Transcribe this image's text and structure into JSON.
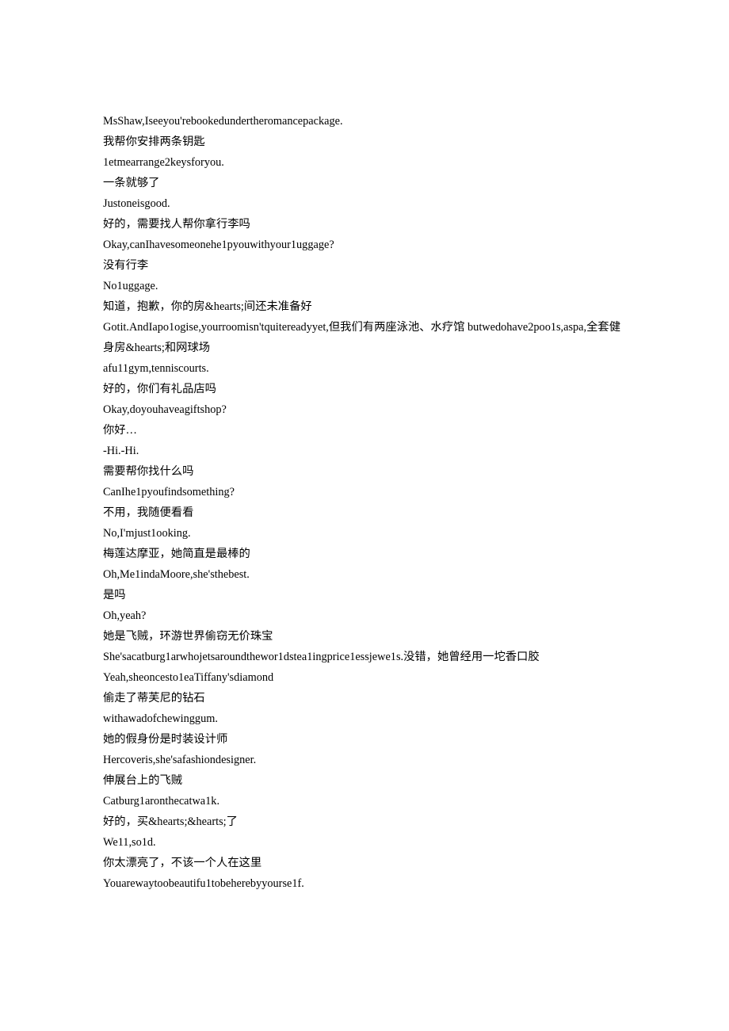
{
  "lines": [
    "MsShaw,Iseeyou'rebookedundertheromancepackage.",
    "我帮你安排两条钥匙",
    "1etmearrange2keysforyou.",
    "一条就够了",
    "Justoneisgood.",
    "好的，需要找人帮你拿行李吗",
    "Okay,canIhavesomeonehe1pyouwithyour1uggage?",
    "没有行李",
    "No1uggage.",
    "知道，抱歉，你的房&hearts;间还未准备好",
    "Gotit.AndIapo1ogise,yourroomisn'tquitereadyyet,但我们有两座泳池、水疗馆 butwedohave2poo1s,aspa,全套健身房&hearts;和网球场",
    "afu11gym,tenniscourts.",
    "好的，你们有礼品店吗",
    "Okay,doyouhaveagiftshop?",
    "你好…",
    "-Hi.-Hi.",
    "需要帮你找什么吗",
    "CanIhe1pyoufindsomething?",
    "不用，我随便看看",
    "No,I'mjust1ooking.",
    "梅莲达摩亚，她简直是最棒的",
    "Oh,Me1indaMoore,she'sthebest.",
    "是吗",
    "Oh,yeah?",
    "她是飞贼，环游世界偷窃无价珠宝",
    "She'sacatburg1arwhojetsaroundthewor1dstea1ingprice1essjewe1s.没错，她曾经用一坨香口胶",
    "Yeah,sheoncesto1eaTiffany'sdiamond",
    "偷走了蒂芙尼的钻石",
    "withawadofchewinggum.",
    "她的假身份是时装设计师",
    "Hercoveris,she'safashiondesigner.",
    "伸展台上的飞贼",
    "Catburg1aronthecatwa1k.",
    "好的，买&hearts;&hearts;了",
    "We11,so1d.",
    "你太漂亮了，不该一个人在这里",
    "Youarewaytoobeautifu1tobeherebyyourse1f."
  ]
}
